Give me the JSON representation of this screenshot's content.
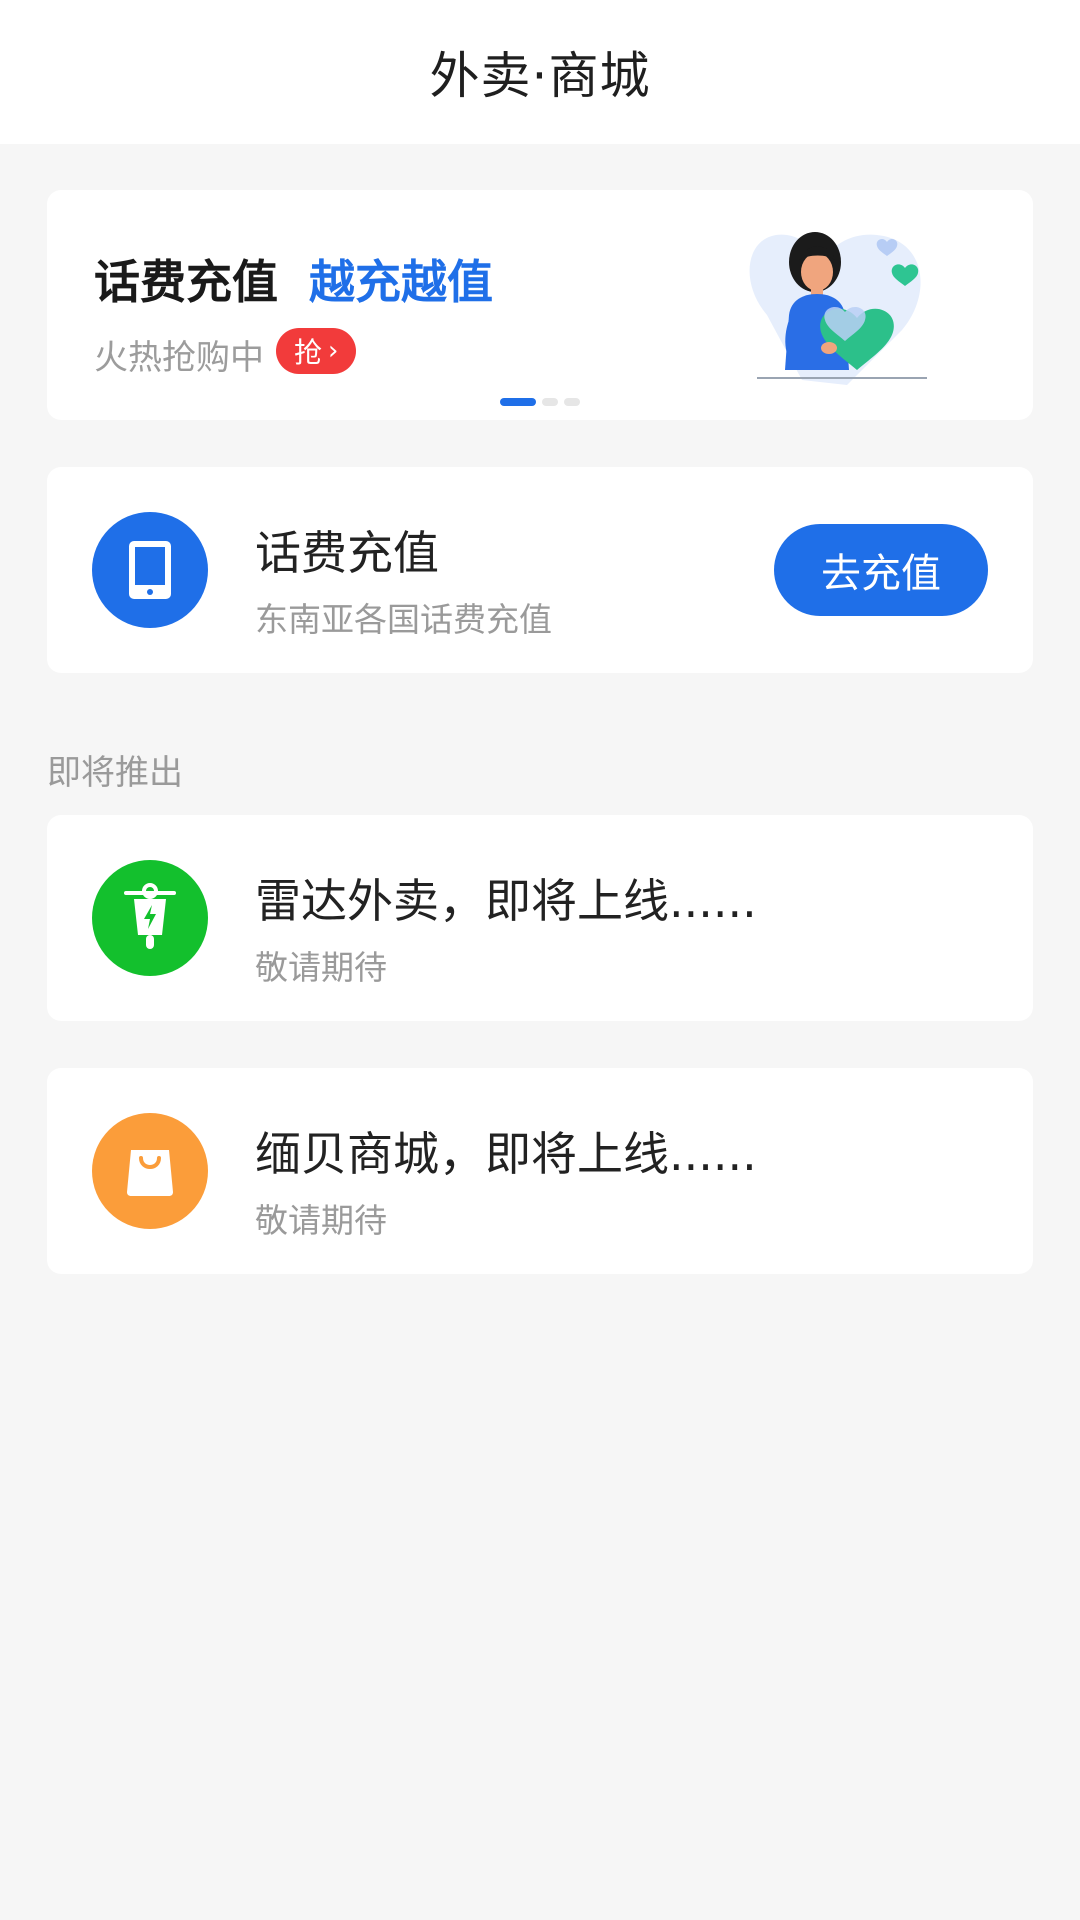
{
  "header": {
    "title": "外卖·商城"
  },
  "banner": {
    "title": "话费充值",
    "accent": "越充越值",
    "subtitle": "火热抢购中",
    "badge_label": "抢",
    "badge_chevron": "›",
    "pages_total": 3,
    "page_active": 1,
    "illustration": "woman-holding-heart-illustration"
  },
  "recharge": {
    "icon": "phone-icon",
    "title": "话费充值",
    "subtitle": "东南亚各国话费充值",
    "button_label": "去充值"
  },
  "upcoming": {
    "section_label": "即将推出",
    "items": [
      {
        "icon": "scooter-icon",
        "title": "雷达外卖，即将上线......",
        "subtitle": "敬请期待"
      },
      {
        "icon": "shopping-bag-icon",
        "title": "缅贝商城，即将上线......",
        "subtitle": "敬请期待"
      }
    ]
  },
  "colors": {
    "accent_blue": "#1f6fe8",
    "badge_red": "#f23b3b",
    "takeout_green": "#13c02d",
    "mall_orange": "#fb9d3a",
    "background": "#f6f6f6"
  }
}
